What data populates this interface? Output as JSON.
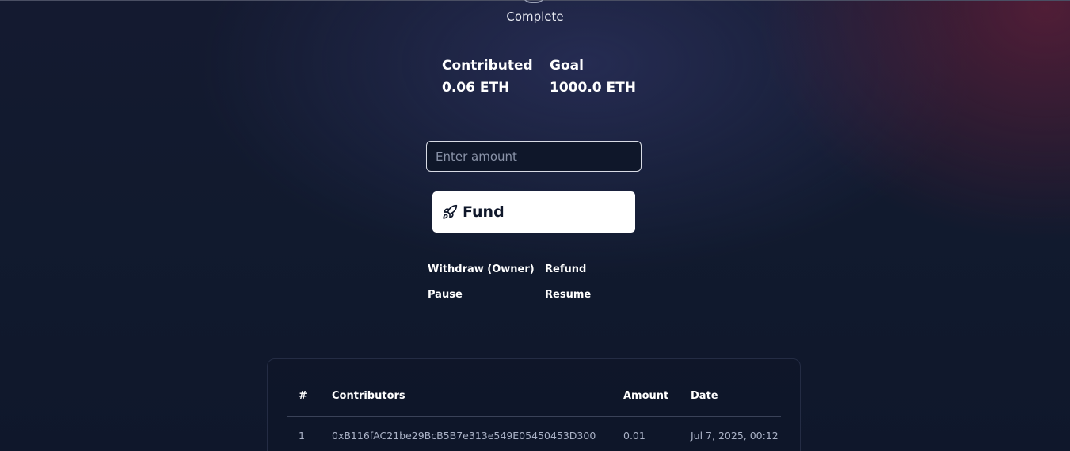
{
  "status": "Complete",
  "stats": {
    "contributed": {
      "label": "Contributed",
      "value": "0.06 ETH"
    },
    "goal": {
      "label": "Goal",
      "value": "1000.0 ETH"
    }
  },
  "fund_form": {
    "amount_placeholder": "Enter amount",
    "amount_value": "",
    "fund_label": "Fund",
    "fund_icon": "rocket-icon"
  },
  "actions": {
    "withdraw": "Withdraw (Owner)",
    "refund": "Refund",
    "pause": "Pause",
    "resume": "Resume"
  },
  "table": {
    "headers": [
      "#",
      "Contributors",
      "Amount",
      "Date"
    ],
    "rows": [
      [
        "1",
        "0xB116fAC21be29BcB5B7e313e549E05450453D300",
        "0.01",
        "Jul 7, 2025, 00:12"
      ]
    ]
  },
  "colors": {
    "background": "#111a2e",
    "accent_glow": "#82203c",
    "button_bg": "#ffffff",
    "button_text": "#0f172a"
  }
}
